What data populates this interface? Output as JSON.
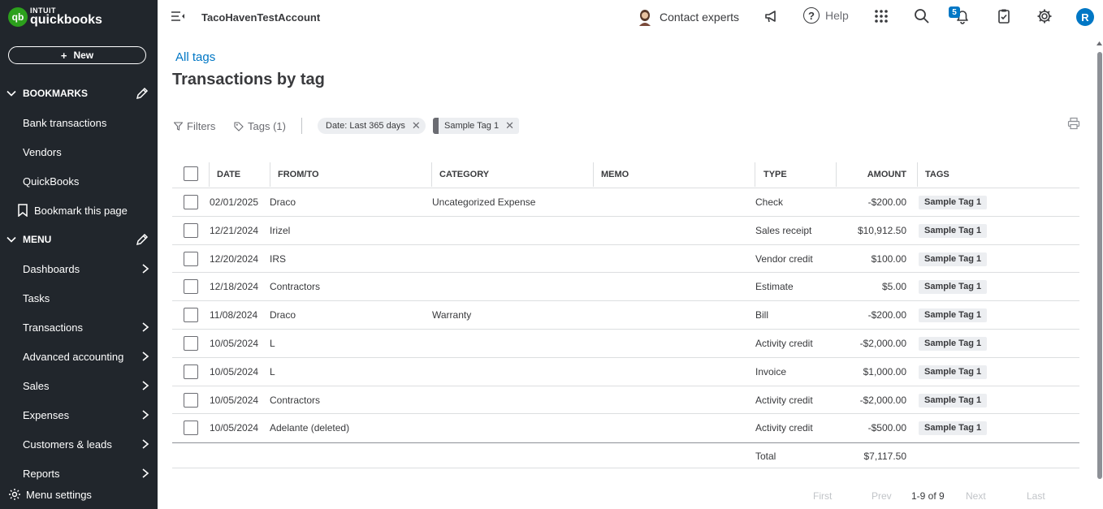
{
  "brand": {
    "intuit": "INTUIT",
    "name": "quickbooks",
    "mark": "qb",
    "accent": "#2ca01c",
    "link": "#0077c5"
  },
  "sidebar": {
    "new_label": "New",
    "bookmarks_title": "BOOKMARKS",
    "bookmarks": [
      {
        "label": "Bank transactions"
      },
      {
        "label": "Vendors"
      },
      {
        "label": "QuickBooks"
      }
    ],
    "bookmark_page_label": "Bookmark this page",
    "menu_title": "MENU",
    "menu": [
      {
        "label": "Dashboards",
        "has_arrow": true
      },
      {
        "label": "Tasks",
        "has_arrow": false
      },
      {
        "label": "Transactions",
        "has_arrow": true
      },
      {
        "label": "Advanced accounting",
        "has_arrow": true
      },
      {
        "label": "Sales",
        "has_arrow": true
      },
      {
        "label": "Expenses",
        "has_arrow": true
      },
      {
        "label": "Customers & leads",
        "has_arrow": true
      },
      {
        "label": "Reports",
        "has_arrow": true
      }
    ],
    "menu_settings_label": "Menu settings"
  },
  "topbar": {
    "company": "TacoHavenTestAccount",
    "contact_label": "Contact experts",
    "help_label": "Help",
    "notification_count": "5",
    "user_initial": "R"
  },
  "main": {
    "breadcrumb": "All tags",
    "title": "Transactions by tag",
    "filters_label": "Filters",
    "tags_label": "Tags (1)",
    "chips": [
      {
        "label": "Date: Last 365 days"
      },
      {
        "label": "Sample Tag 1"
      }
    ]
  },
  "table": {
    "columns": [
      "DATE",
      "FROM/TO",
      "CATEGORY",
      "MEMO",
      "TYPE",
      "AMOUNT",
      "TAGS"
    ],
    "rows": [
      {
        "date": "02/01/2025",
        "from_to": "Draco",
        "category": "Uncategorized Expense",
        "memo": "",
        "type": "Check",
        "amount": "-$200.00",
        "tag": "Sample Tag 1"
      },
      {
        "date": "12/21/2024",
        "from_to": "Irizel",
        "category": "",
        "memo": "",
        "type": "Sales receipt",
        "amount": "$10,912.50",
        "tag": "Sample Tag 1"
      },
      {
        "date": "12/20/2024",
        "from_to": "IRS",
        "category": "",
        "memo": "",
        "type": "Vendor credit",
        "amount": "$100.00",
        "tag": "Sample Tag 1"
      },
      {
        "date": "12/18/2024",
        "from_to": "Contractors",
        "category": "",
        "memo": "",
        "type": "Estimate",
        "amount": "$5.00",
        "tag": "Sample Tag 1"
      },
      {
        "date": "11/08/2024",
        "from_to": "Draco",
        "category": "Warranty",
        "memo": "",
        "type": "Bill",
        "amount": "-$200.00",
        "tag": "Sample Tag 1"
      },
      {
        "date": "10/05/2024",
        "from_to": "L",
        "category": "",
        "memo": "",
        "type": "Activity credit",
        "amount": "-$2,000.00",
        "tag": "Sample Tag 1"
      },
      {
        "date": "10/05/2024",
        "from_to": "L",
        "category": "",
        "memo": "",
        "type": "Invoice",
        "amount": "$1,000.00",
        "tag": "Sample Tag 1"
      },
      {
        "date": "10/05/2024",
        "from_to": "Contractors",
        "category": "",
        "memo": "",
        "type": "Activity credit",
        "amount": "-$2,000.00",
        "tag": "Sample Tag 1"
      },
      {
        "date": "10/05/2024",
        "from_to": "Adelante (deleted)",
        "category": "",
        "memo": "",
        "type": "Activity credit",
        "amount": "-$500.00",
        "tag": "Sample Tag 1"
      }
    ],
    "total_label": "Total",
    "total_amount": "$7,117.50"
  },
  "pagination": {
    "first": "First",
    "prev": "Prev",
    "count": "1-9 of 9",
    "next": "Next",
    "last": "Last"
  }
}
